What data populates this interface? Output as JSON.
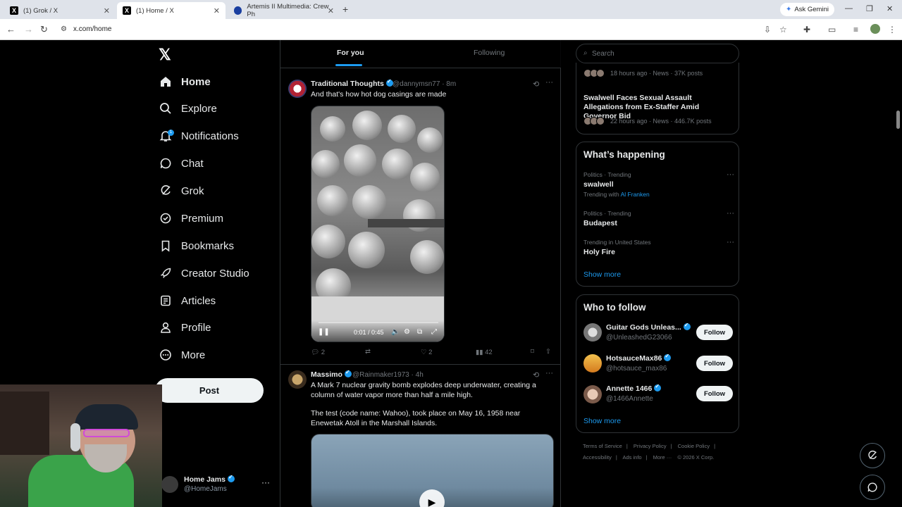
{
  "browser": {
    "tabs": [
      {
        "title": "(1) Grok / X",
        "active": false
      },
      {
        "title": "(1) Home / X",
        "active": true
      },
      {
        "title": "Artemis II Multimedia: Crew Ph",
        "active": false
      }
    ],
    "ask_gemini": "Ask Gemini",
    "url": "x.com/home"
  },
  "nav": {
    "items": [
      {
        "label": "Home",
        "icon": "home-icon"
      },
      {
        "label": "Explore",
        "icon": "search-icon"
      },
      {
        "label": "Notifications",
        "icon": "bell-icon",
        "badge": "1"
      },
      {
        "label": "Chat",
        "icon": "chat-icon"
      },
      {
        "label": "Grok",
        "icon": "grok-icon"
      },
      {
        "label": "Premium",
        "icon": "premium-icon"
      },
      {
        "label": "Bookmarks",
        "icon": "bookmark-icon"
      },
      {
        "label": "Creator Studio",
        "icon": "rocket-icon"
      },
      {
        "label": "Articles",
        "icon": "articles-icon"
      },
      {
        "label": "Profile",
        "icon": "person-icon"
      },
      {
        "label": "More",
        "icon": "more-circle-icon"
      }
    ],
    "post_label": "Post",
    "account": {
      "name": "Home Jams",
      "handle": "@HomeJams"
    }
  },
  "timeline": {
    "tabs": [
      "For you",
      "Following"
    ],
    "tweets": [
      {
        "name": "Traditional Thoughts",
        "handle": "@dannymsn77",
        "time": "· 8m",
        "text": "And that's how hot dog casings are made",
        "video_time": "0:01 / 0:45",
        "replies": "2",
        "reposts": "",
        "likes": "2",
        "views": "42"
      },
      {
        "name": "Massimo",
        "handle": "@Rainmaker1973",
        "time": "· 4h",
        "text1": "A Mark 7 nuclear gravity bomb explodes deep underwater, creating a column of water vapor more than half a mile high.",
        "text2": "The test (code name: Wahoo), took place on May 16, 1958 near Enewetak Atoll in the Marshall Islands."
      }
    ]
  },
  "right": {
    "search_placeholder": "Search",
    "news": [
      {
        "meta": "18 hours ago · News · 37K posts"
      },
      {
        "title": "Swalwell Faces Sexual Assault Allegations from Ex-Staffer Amid Governor Bid",
        "meta": "22 hours ago · News · 446.7K posts"
      }
    ],
    "whats_happening": {
      "title": "What’s happening",
      "trends": [
        {
          "category": "Politics · Trending",
          "name": "swalwell",
          "with_prefix": "Trending with",
          "with_link": "Al Franken"
        },
        {
          "category": "Politics · Trending",
          "name": "Budapest"
        },
        {
          "category": "Trending in United States",
          "name": "Holy Fire"
        }
      ],
      "show_more": "Show more"
    },
    "who_to_follow": {
      "title": "Who to follow",
      "accounts": [
        {
          "name": "Guitar Gods Unleas...",
          "handle": "@UnleashedG23066",
          "button": "Follow"
        },
        {
          "name": "HotsauceMax86",
          "handle": "@hotsauce_max86",
          "button": "Follow"
        },
        {
          "name": "Annette 1466",
          "handle": "@1466Annette",
          "button": "Follow"
        }
      ],
      "show_more": "Show more"
    },
    "footer": {
      "line1": [
        "Terms of Service",
        "|",
        "Privacy Policy",
        "|",
        "Cookie Policy",
        "|"
      ],
      "line2": [
        "Accessibility",
        "|",
        "Ads info",
        "|",
        "More ···",
        "© 2026 X Corp."
      ]
    }
  }
}
